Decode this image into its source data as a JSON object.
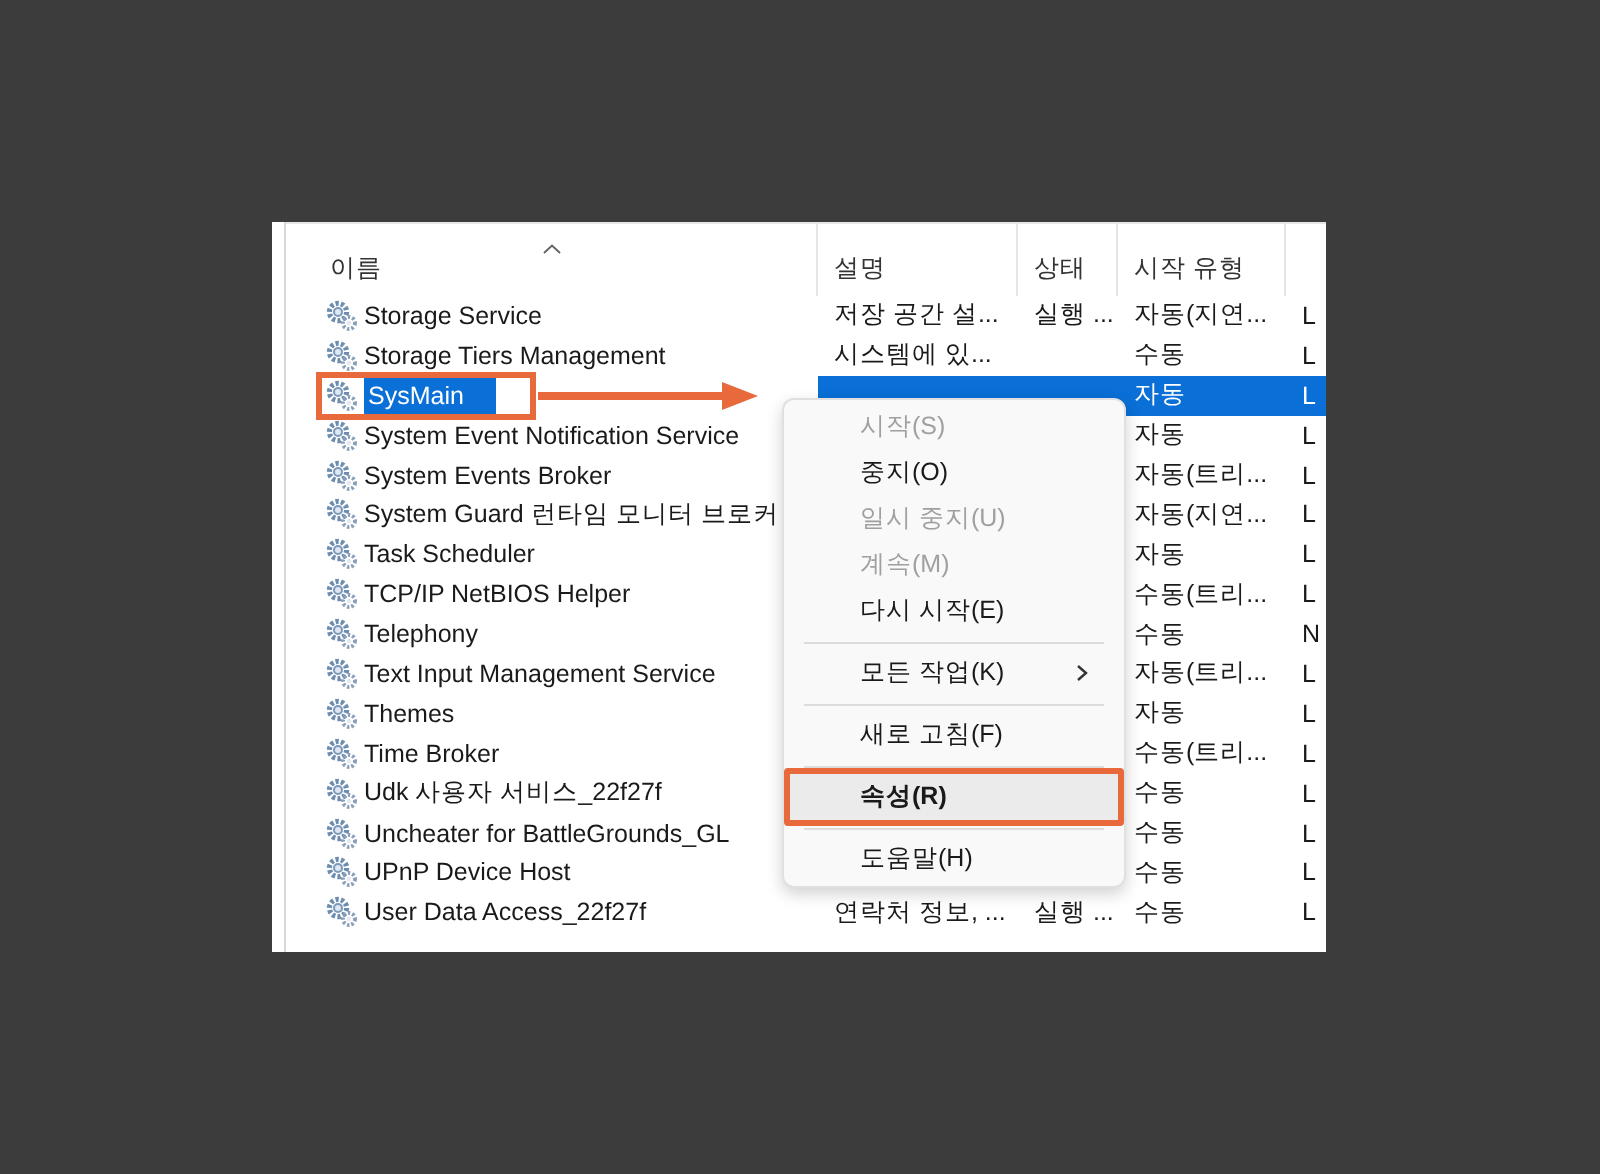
{
  "columns": [
    {
      "label": "이름",
      "sorted": true
    },
    {
      "label": "설명",
      "sorted": false
    },
    {
      "label": "상태",
      "sorted": false
    },
    {
      "label": "시작 유형",
      "sorted": false
    }
  ],
  "rows": [
    {
      "name": "Storage Service",
      "description": "저장 공간 설...",
      "status": "실행 ...",
      "startup": "자동(지연...",
      "column_5": "L",
      "selected": false,
      "outlined": false
    },
    {
      "name": "Storage Tiers Management",
      "description": "시스템에 있...",
      "startup": "수동",
      "column_5": "L",
      "selected": false,
      "outlined": false
    },
    {
      "name": "SysMain",
      "startup": "자동",
      "column_5": "L",
      "selected": true,
      "outlined": true
    },
    {
      "name": "System Event Notification Service",
      "startup": "자동",
      "column_5": "L",
      "selected": false,
      "outlined": false
    },
    {
      "name": "System Events Broker",
      "startup": "자동(트리...",
      "column_5": "L",
      "selected": false,
      "outlined": false
    },
    {
      "name": "System Guard 런타임 모니터 브로커",
      "startup": "자동(지연...",
      "column_5": "L",
      "selected": false,
      "outlined": false
    },
    {
      "name": "Task Scheduler",
      "startup": "자동",
      "column_5": "L",
      "selected": false,
      "outlined": false
    },
    {
      "name": "TCP/IP NetBIOS Helper",
      "startup": "수동(트리...",
      "column_5": "L",
      "selected": false,
      "outlined": false
    },
    {
      "name": "Telephony",
      "startup": "수동",
      "column_5": "N",
      "selected": false,
      "outlined": false
    },
    {
      "name": "Text Input Management Service",
      "startup": "자동(트리...",
      "column_5": "L",
      "selected": false,
      "outlined": false
    },
    {
      "name": "Themes",
      "startup": "자동",
      "column_5": "L",
      "selected": false,
      "outlined": false
    },
    {
      "name": "Time Broker",
      "startup": "수동(트리...",
      "column_5": "L",
      "selected": false,
      "outlined": false
    },
    {
      "name": "Udk 사용자 서비스_22f27f",
      "startup": "수동",
      "column_5": "L",
      "selected": false,
      "outlined": false
    },
    {
      "name": "Uncheater for BattleGrounds_GL",
      "startup": "수동",
      "column_5": "L",
      "selected": false,
      "outlined": false
    },
    {
      "name": "UPnP Device Host",
      "startup": "수동",
      "column_5": "L",
      "selected": false,
      "outlined": false
    },
    {
      "name": "User Data Access_22f27f",
      "description": "연락처 정보, ...",
      "status": "실행 ...",
      "startup": "수동",
      "column_5": "L",
      "selected": false,
      "outlined": false
    }
  ],
  "arrow": true,
  "context_menu": [
    {
      "kind": "item",
      "label": "시작(S)",
      "disabled": true,
      "default": false,
      "hovered": false,
      "outlined": false
    },
    {
      "kind": "item",
      "label": "중지(O)",
      "disabled": false,
      "default": false,
      "hovered": false,
      "outlined": false
    },
    {
      "kind": "item",
      "label": "일시 중지(U)",
      "disabled": true,
      "default": false,
      "hovered": false,
      "outlined": false
    },
    {
      "kind": "item",
      "label": "계속(M)",
      "disabled": true,
      "default": false,
      "hovered": false,
      "outlined": false
    },
    {
      "kind": "item",
      "label": "다시 시작(E)",
      "disabled": false,
      "default": false,
      "hovered": false,
      "outlined": false
    },
    {
      "kind": "separator"
    },
    {
      "kind": "submenu",
      "label": "모든 작업(K)",
      "disabled": false,
      "default": false,
      "hovered": false,
      "outlined": false
    },
    {
      "kind": "separator"
    },
    {
      "kind": "item",
      "label": "새로 고침(F)",
      "disabled": false,
      "default": false,
      "hovered": false,
      "outlined": false
    },
    {
      "kind": "separator"
    },
    {
      "kind": "item",
      "label": "속성(R)",
      "disabled": false,
      "default": true,
      "hovered": true,
      "outlined": true
    },
    {
      "kind": "separator"
    },
    {
      "kind": "item",
      "label": "도움말(H)",
      "disabled": false,
      "default": false,
      "hovered": false,
      "outlined": false
    }
  ]
}
